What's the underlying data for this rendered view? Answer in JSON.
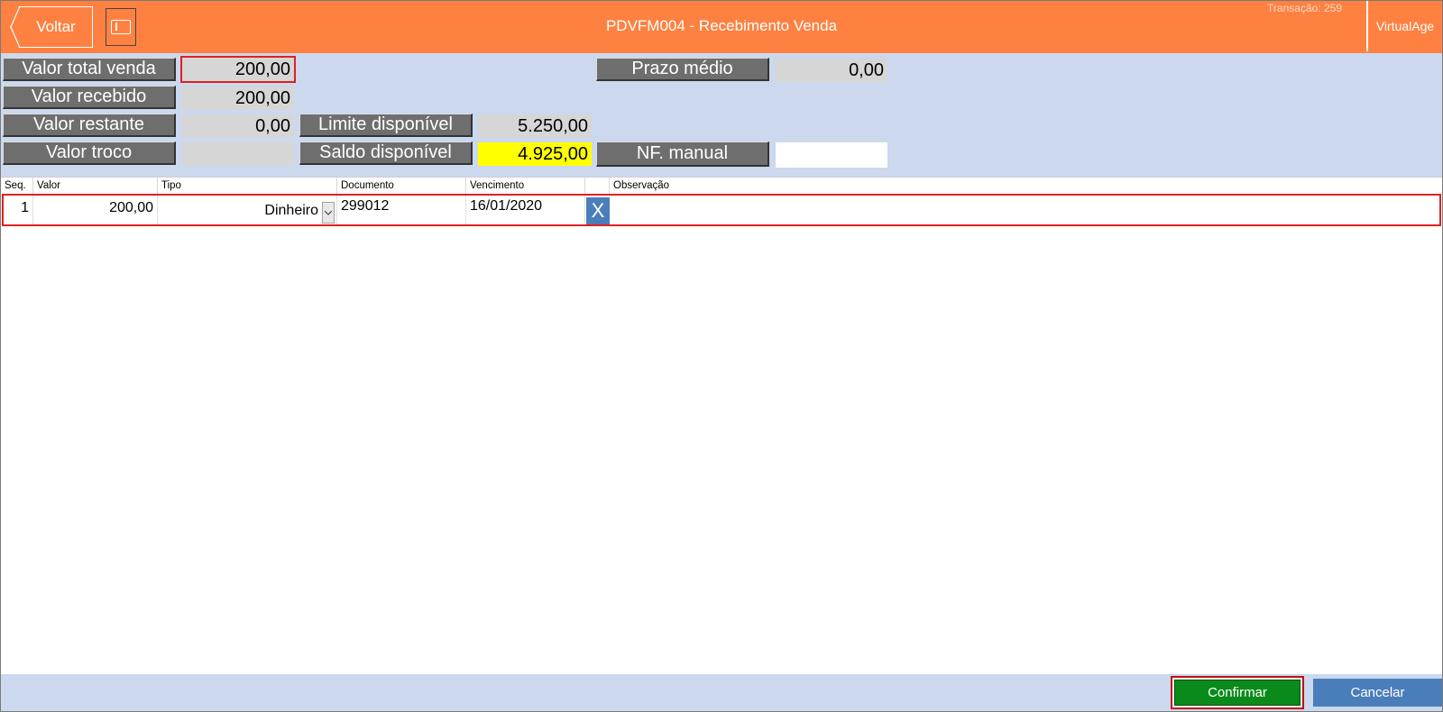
{
  "header": {
    "back_label": "Voltar",
    "title": "PDVFM004 - Recebimento Venda",
    "transacao": "Transação: 259",
    "brand": "VirtualAge"
  },
  "form": {
    "valor_total_venda": {
      "label": "Valor total venda",
      "value": "200,00"
    },
    "valor_recebido": {
      "label": "Valor recebido",
      "value": "200,00"
    },
    "valor_restante": {
      "label": "Valor restante",
      "value": "0,00"
    },
    "valor_troco": {
      "label": "Valor troco",
      "value": ""
    },
    "limite_disponivel": {
      "label": "Limite disponível",
      "value": "5.250,00"
    },
    "saldo_disponivel": {
      "label": "Saldo disponível",
      "value": "4.925,00"
    },
    "prazo_medio": {
      "label": "Prazo médio",
      "value": "0,00"
    },
    "nf_manual": {
      "label": "NF. manual",
      "value": ""
    }
  },
  "grid": {
    "columns": [
      "Seq.",
      "Valor",
      "Tipo",
      "Documento",
      "Vencimento",
      "",
      "Observação"
    ],
    "rows": [
      {
        "seq": "1",
        "valor": "200,00",
        "tipo": "Dinheiro",
        "documento": "299012",
        "vencimento": "16/01/2020",
        "delete": "X",
        "observacao": ""
      }
    ]
  },
  "footer": {
    "confirm_label": "Confirmar",
    "cancel_label": "Cancelar"
  },
  "colors": {
    "header": "#FF8141",
    "panel": "#CBD8EE",
    "label_bg": "#6E6E6E",
    "highlight_yellow": "#FFFF00",
    "confirm": "#0A8A1A",
    "cancel": "#4A7EBB"
  },
  "icons": {
    "back": "chevron-left-icon",
    "toggle": "panel-toggle-icon",
    "dropdown": "chevron-down-icon",
    "delete": "close-icon"
  }
}
